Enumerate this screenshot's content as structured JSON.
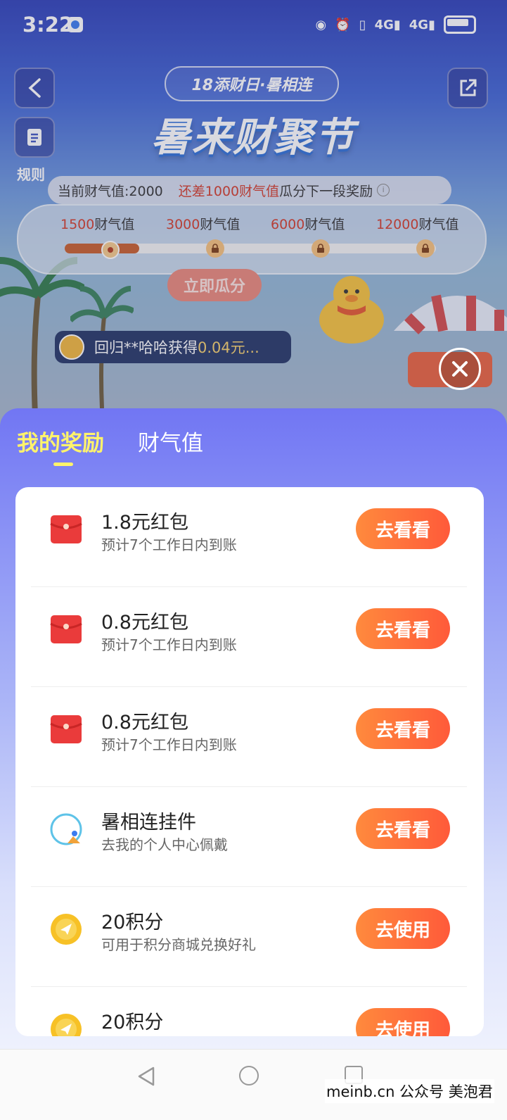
{
  "status_bar": {
    "time": "3:22",
    "network_1": "4G",
    "network_2": "4G"
  },
  "header": {
    "subtitle": "18添财日·暑相连",
    "title": "暑来财聚节",
    "rules_label": "规则"
  },
  "wealth": {
    "current_label": "当前财气值:2000",
    "shortfall_label": "还差1000财气值",
    "shortfall_suffix": "瓜分下一段奖励",
    "milestones": [
      {
        "num": "1500",
        "unit": "财气值"
      },
      {
        "num": "3000",
        "unit": "财气值"
      },
      {
        "num": "6000",
        "unit": "财气值"
      },
      {
        "num": "12000",
        "unit": "财气值"
      }
    ],
    "claim_button": "立即瓜分"
  },
  "ticker": {
    "text": "回归**哈哈获得",
    "amount": "0.04元..."
  },
  "tabs": {
    "active": "我的奖励",
    "inactive": "财气值"
  },
  "rewards": [
    {
      "title": "1.8元红包",
      "subtitle": "预计7个工作日内到账",
      "button": "去看看",
      "icon": "red-envelope-icon"
    },
    {
      "title": "0.8元红包",
      "subtitle": "预计7个工作日内到账",
      "button": "去看看",
      "icon": "red-envelope-icon"
    },
    {
      "title": "0.8元红包",
      "subtitle": "预计7个工作日内到账",
      "button": "去看看",
      "icon": "red-envelope-icon"
    },
    {
      "title": "暑相连挂件",
      "subtitle": "去我的个人中心佩戴",
      "button": "去看看",
      "icon": "pendant-icon"
    },
    {
      "title": "20积分",
      "subtitle": "可用于积分商城兑换好礼",
      "button": "去使用",
      "icon": "points-coin-icon"
    },
    {
      "title": "20积分",
      "subtitle": "",
      "button": "去使用",
      "icon": "points-coin-icon"
    }
  ],
  "watermark": "meinb.cn 公众号 美泡君",
  "colors": {
    "accent": "#ff6a3a",
    "tab_active": "#fff36b",
    "sheet_top": "#7176f3"
  }
}
